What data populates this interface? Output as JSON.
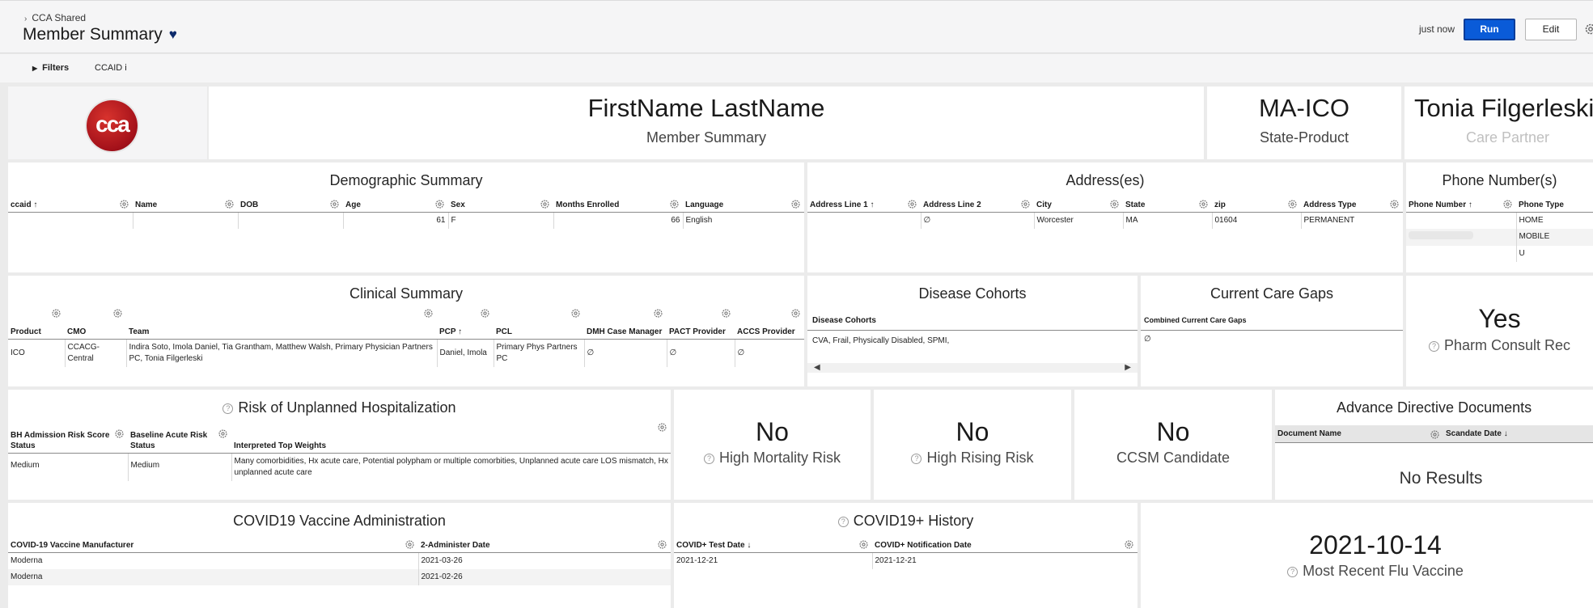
{
  "header": {
    "breadcrumb": "CCA Shared",
    "title": "Member Summary",
    "updated": "just now",
    "run_label": "Run",
    "edit_label": "Edit"
  },
  "filters": {
    "label": "Filters",
    "ccaid_label": "CCAID i"
  },
  "logo": {
    "text": "cca",
    "color": "#b4141c"
  },
  "member": {
    "name": "FirstName LastName",
    "subtitle": "Member Summary"
  },
  "product": {
    "value": "MA-ICO",
    "label": "State-Product"
  },
  "care_partner": {
    "value": "Tonia Filgerleski",
    "label": "Care Partner"
  },
  "demographic": {
    "title": "Demographic Summary",
    "columns": [
      "ccaid ↑",
      "Name",
      "DOB",
      "Age",
      "Sex",
      "Months Enrolled",
      "Language"
    ],
    "row": {
      "age": "61",
      "sex": "F",
      "months": "66",
      "language": "English"
    }
  },
  "address": {
    "title": "Address(es)",
    "columns": [
      "Address Line 1 ↑",
      "Address Line 2",
      "City",
      "State",
      "zip",
      "Address Type"
    ],
    "row": {
      "line2": "∅",
      "city": "Worcester",
      "state": "MA",
      "zip": "01604",
      "type": "PERMANENT"
    }
  },
  "phone": {
    "title": "Phone Number(s)",
    "columns": [
      "Phone Number ↑",
      "Phone Type"
    ],
    "types": [
      "HOME",
      "MOBILE",
      "U"
    ]
  },
  "clinical": {
    "title": "Clinical Summary",
    "columns": [
      "Product",
      "CMO",
      "Team",
      "PCP ↑",
      "PCL",
      "DMH Case Manager",
      "PACT Provider",
      "ACCS Provider"
    ],
    "row": {
      "product": "ICO",
      "cmo": "CCACG-Central",
      "team": "Indira Soto, Imola Daniel, Tia Grantham, Matthew Walsh, Primary Physician Partners PC, Tonia Filgerleski",
      "pcp": "Daniel, Imola",
      "pcl": "Primary Phys Partners PC",
      "dmh": "∅",
      "pact": "∅",
      "accs": "∅"
    }
  },
  "cohorts": {
    "title": "Disease Cohorts",
    "column": "Disease Cohorts",
    "value": "CVA, Frail, Physically Disabled, SPMI,"
  },
  "care_gaps": {
    "title": "Current Care Gaps",
    "column": "Combined Current Care Gaps",
    "value": "∅"
  },
  "pharm": {
    "value": "Yes",
    "label": "Pharm Consult Rec"
  },
  "risk": {
    "title": "Risk of Unplanned Hospitalization",
    "columns": [
      "BH Admission Risk Score Status",
      "Baseline Acute Risk Status",
      "Interpreted Top Weights"
    ],
    "row": {
      "bh": "Medium",
      "baseline": "Medium",
      "weights": "Many comorbidities, Hx acute care, Potential polypham or multiple comorbities, Unplanned acute care LOS mismatch, Hx unplanned acute care"
    },
    "medium_color": "#9a7a00"
  },
  "mortality": {
    "value": "No",
    "label": "High Mortality Risk"
  },
  "rising": {
    "value": "No",
    "label": "High Rising Risk"
  },
  "ccsm": {
    "value": "No",
    "label": "CCSM Candidate"
  },
  "advance": {
    "title": "Advance Directive Documents",
    "columns": [
      "Document Name",
      "Scandate Date ↓"
    ],
    "empty": "No Results"
  },
  "covid_vax": {
    "title": "COVID19 Vaccine Administration",
    "columns": [
      "COVID-19 Vaccine Manufacturer",
      "2-Administer Date"
    ],
    "rows": [
      {
        "manufacturer": "Moderna",
        "date": "2021-03-26"
      },
      {
        "manufacturer": "Moderna",
        "date": "2021-02-26"
      }
    ]
  },
  "covid_hist": {
    "title": "COVID19+ History",
    "columns": [
      "COVID+ Test Date ↓",
      "COVID+ Notification Date"
    ],
    "rows": [
      {
        "test": "2021-12-21",
        "notify": "2021-12-21"
      }
    ]
  },
  "flu": {
    "value": "2021-10-14",
    "label": "Most Recent Flu Vaccine"
  },
  "colors": {
    "run_button": "#0a5bd8",
    "heart": "#0d2a6b"
  }
}
